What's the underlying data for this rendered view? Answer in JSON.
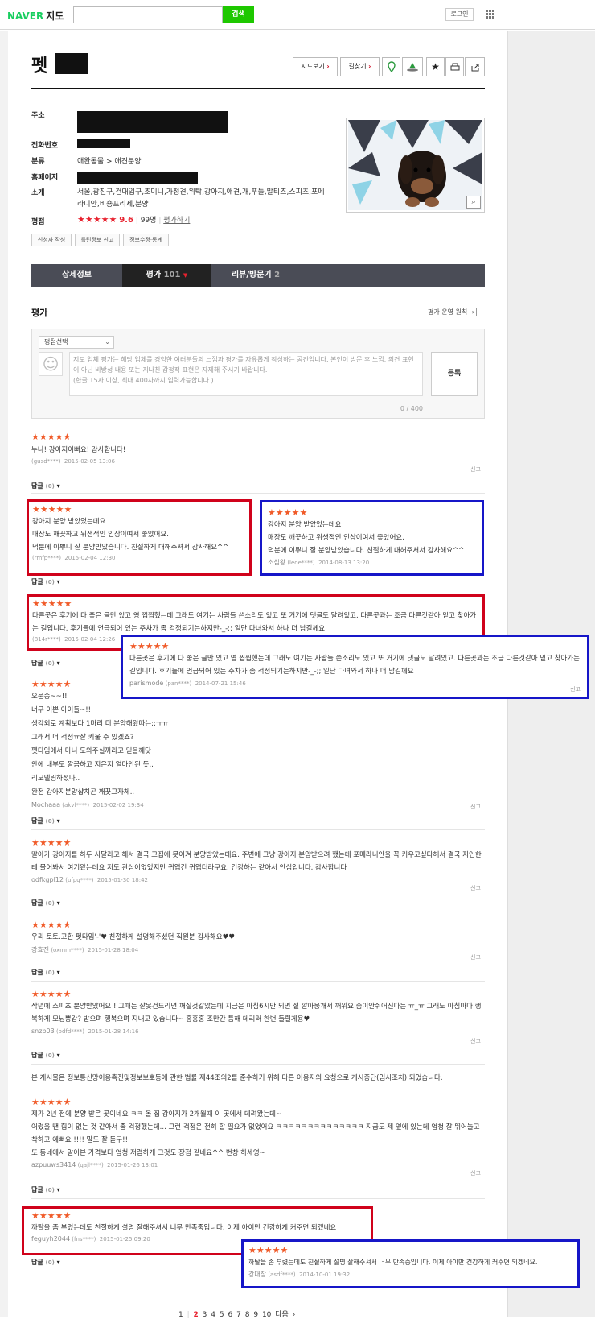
{
  "header": {
    "logo_brand": "NAVER",
    "logo_service": "지도",
    "search_button": "검색",
    "login": "로그인"
  },
  "place": {
    "title": "펫",
    "buttons": {
      "map": "지도보기",
      "route": "길찾기"
    },
    "labels": {
      "address": "주소",
      "phone": "전화번호",
      "category": "분류",
      "homepage": "홈페이지",
      "intro": "소개",
      "rating": "평점"
    },
    "category": "애완동물 > 애견분양",
    "intro": "서울,광진구,건대입구,초미니,가정견,위탁,강아지,애견,개,푸들,말티즈,스피츠,포메라니안,비숑프리제,분양",
    "stars": "★★★★★",
    "score": "9.6",
    "raters": "99명",
    "rate_link": "평가하기",
    "small_buttons": [
      "신청자 작성",
      "틀린정보 신고",
      "정보수정·통계"
    ]
  },
  "tabs": {
    "detail": "상세정보",
    "rating": "평가",
    "rating_count": "101",
    "review": "리뷰/방문기",
    "review_count": "2"
  },
  "section": {
    "title": "평가",
    "policy": "평가 운영 원칙"
  },
  "compose": {
    "select": "평점선택",
    "placeholder": "지도 업체 평가는 해당 업체를 경험한 여러분들의 느낌과 평가를 자유롭게 작성하는 공간입니다. 본인이 방문 후 느낌, 의견 표현이 아닌 비방성 내용 또는 지나친 감정적 표현은 자제해 주시기 바랍니다.",
    "hint": "(한글 15자 이상, 최대 400자까지 입력가능합니다.)",
    "submit": "등록",
    "counter": "0 / 400"
  },
  "common": {
    "reply": "답글",
    "reply_count": "(0)",
    "report": "신고"
  },
  "reviews": [
    {
      "stars": "★★★★★",
      "text": "누나! 강아지이뻐요! 감사합니다!",
      "user": "(gusd****)",
      "date": "2015-02-05 13:06"
    },
    {
      "stars": "★★★★★",
      "text": "강아지 분양 받았었는데요\n매장도 깨끗하고 위생적인 인상이여서 좋았어요.\n덕분에 이뿌니 잘 분양받았습니다. 친절하게 대해주셔서 감사해요^^",
      "user": "(rmfp****)",
      "date": "2015-02-04 12:30"
    },
    {
      "stars": "★★★★★",
      "text": "다른곳은 후기에 다 좋은 글만 있고 영 찝찝했는데 그래도 여기는 사람들 쓴소리도 있고 또 거기에 댓글도 달려있고. 다른곳과는 조금 다른것같아 믿고 찾아가는 길입니다. 후기들에 언급되어 있는 주차가 좀 걱정되기는하지만-_-;; 일단 다녀와서 하나 더 남길께요",
      "user": "(814r****)",
      "date": "2015-02-04 12:26"
    },
    {
      "stars": "★★★★★",
      "text": "오운송~~!!\n너무 이쁜 아이들~!!\n생각외로 계획보다 1마리 더 분양해왔따는;;ㅠㅠ\n그래서 더 걱정ㅠ잘 키울 수 있겠죠?\n펫타임에서 마니 도와주실꺼라고 믿을께닷\n안에 내부도 깔끔하고 지은지 얼마안된 듯..\n리모델링하셨나..\n완전 강아지분양샵치곤 깨끗그자체..",
      "name": "Mochaaa",
      "user": "(akvl****)",
      "date": "2015-02-02 19:34"
    },
    {
      "stars": "★★★★★",
      "text": "딸아가 강아지를 하두 사달라고 해서 결국 고집에 못이겨 분양받았는데요. 주변에 그냥 강아지 분양받으려 했는데 포메라니안을 꼭 키우고싶다해서 결국 지인한테 물어봐서 여기왔는데요 저도 관심이없었지만 귀엽긴 귀엽더라구요. 건강하는 같아서 안심입니다. 감사합니다",
      "name": "odfkgpl12",
      "user": "(ufpq****)",
      "date": "2015-01-30 18:42"
    },
    {
      "stars": "★★★★★",
      "text": "우리 토토.고환 펫타임'-'♥ 친절하게 설명해주셨던 직원분 감사해요♥♥",
      "name": "강효진",
      "user": "(oxmm****)",
      "date": "2015-01-28 18:04"
    },
    {
      "stars": "★★★★★",
      "text": "작년에 스피츠 분양받았어요 ! 그때는 잘못건드리면 깨질것같았는데 지금은 아침6시만 되면 절 깔아뭉개서 깨워요 숨이안쉬어진다는 ㅠ_ㅠ 그래도 아침마다 행복하게 모닝뽕감? 받으며 행복으며 지내고 있습니다~ 홍홍홍 조만간 틈해 데리러 한번 들릴게용♥",
      "name": "snzb03",
      "user": "(odfd****)",
      "date": "2015-01-28 14:16"
    },
    {
      "notice": "본 게시물은 정보통신망이용촉진및정보보호등에 관한 법률 제44조의2를 준수하기 위해 다른 이용자의 요청으로 게시중단(임시조치) 되었습니다."
    },
    {
      "stars": "★★★★★",
      "text": "제가 2년 전에 분양 받은 곳이네요 ㅋㅋ 올 집 강아지가 2개월때 이 곳에서 데려왔는데~\n어렸을 땐 힘이 없는 것 같아서 좀 걱정했는데... 그런 걱정은 전혀 할 필요가 없었어요 ㅋㅋㅋㅋㅋㅋㅋㅋㅋㅋㅋㅋㅋㅋ 지금도 제 옆에 있는데 엄청 잘 뛰어놀고 착하고 예뻐요 !!!! 말도 잘 듣구!!\n또 동네에서 알아본 가격보다 엄청 저렴하게 그것도 장점 같네요^^ 번창 하세영~",
      "name": "azpuuws3414",
      "user": "(qajl****)",
      "date": "2015-01-26 13:01"
    },
    {
      "stars": "★★★★★",
      "text": "까탈을 좀 부렸는데도 친절하게 설명 잘해주셔서 너무 만족중입니다. 이제 아이만 건강하게 커주면 되겠네요",
      "name": "feguyh2044",
      "user": "(fns****)",
      "date": "2015-01-25 09:20"
    }
  ],
  "overlays": [
    {
      "stars": "★★★★★",
      "text": "강아지 분양 받았었는데요\n매장도 깨끗하고 위생적인 인상이여서 좋았어요.\n덕분에 이뿌니 잘 분양받았습니다. 친절하게 대해주셔서 감사해요^^",
      "name": "소심왕",
      "user": "(leoe****)",
      "date": "2014-08-13 13:20"
    },
    {
      "stars": "★★★★★",
      "text": "다른곳은 후기에 다 좋은 글만 있고 영 찝찝했는데 그래도 여기는 사람들 쓴소리도 있고 또 거기에 댓글도 달려있고. 다른곳과는 조금 다른것같아 믿고 찾아가는 길입니다. 후기들에 언급되어 있는 주차가 좀 걱정되기는하지만-_-;; 일단 다녀와서 하나 더 남길께요",
      "name": "parismode",
      "user": "(pan****)",
      "date": "2014-07-21 15:46"
    },
    {
      "stars": "★★★★★",
      "text": "까탈을 좀 부렸는데도 친절하게 설명 잘해주셔서 너무 만족중입니다. 이제 아이만 건강하게 커주면 되겠네요.",
      "name": "강대장",
      "user": "(asdf****)",
      "date": "2014-10-01 19:32"
    }
  ],
  "pagination": {
    "pages": [
      "1",
      "2",
      "3",
      "4",
      "5",
      "6",
      "7",
      "8",
      "9",
      "10"
    ],
    "current": "2",
    "next": "다음"
  }
}
